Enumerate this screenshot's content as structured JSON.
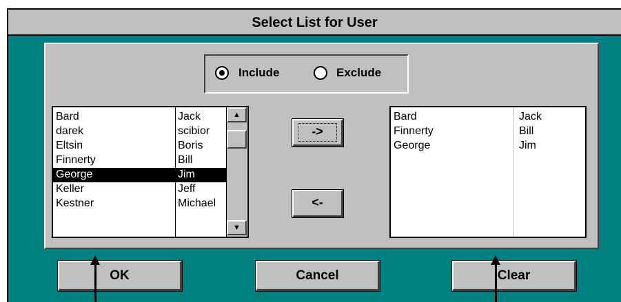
{
  "window": {
    "title": "Select List for User"
  },
  "mode": {
    "include_label": "Include",
    "exclude_label": "Exclude",
    "selected": "Include"
  },
  "available_list": {
    "rows": [
      {
        "last": "Bard",
        "first": "Jack",
        "selected": false
      },
      {
        "last": "darek",
        "first": "scibior",
        "selected": false
      },
      {
        "last": "Eltsin",
        "first": "Boris",
        "selected": false
      },
      {
        "last": "Finnerty",
        "first": "Bill",
        "selected": false
      },
      {
        "last": "George",
        "first": "Jim",
        "selected": true
      },
      {
        "last": "Keller",
        "first": "Jeff",
        "selected": false
      },
      {
        "last": "Kestner",
        "first": "Michael",
        "selected": false
      }
    ],
    "scroll": {
      "up_icon": "arrow-up-icon",
      "down_icon": "arrow-down-icon"
    }
  },
  "selected_list": {
    "rows": [
      {
        "last": "Bard",
        "first": "Jack"
      },
      {
        "last": "Finnerty",
        "first": "Bill"
      },
      {
        "last": "George",
        "first": "Jim"
      }
    ]
  },
  "move_buttons": {
    "add_label": "->",
    "remove_label": "<-"
  },
  "buttons": {
    "ok_label": "OK",
    "cancel_label": "Cancel",
    "clear_label": "Clear"
  },
  "colors": {
    "desktop": "#008080",
    "face": "#c0c0c0",
    "selection": "#000000"
  }
}
